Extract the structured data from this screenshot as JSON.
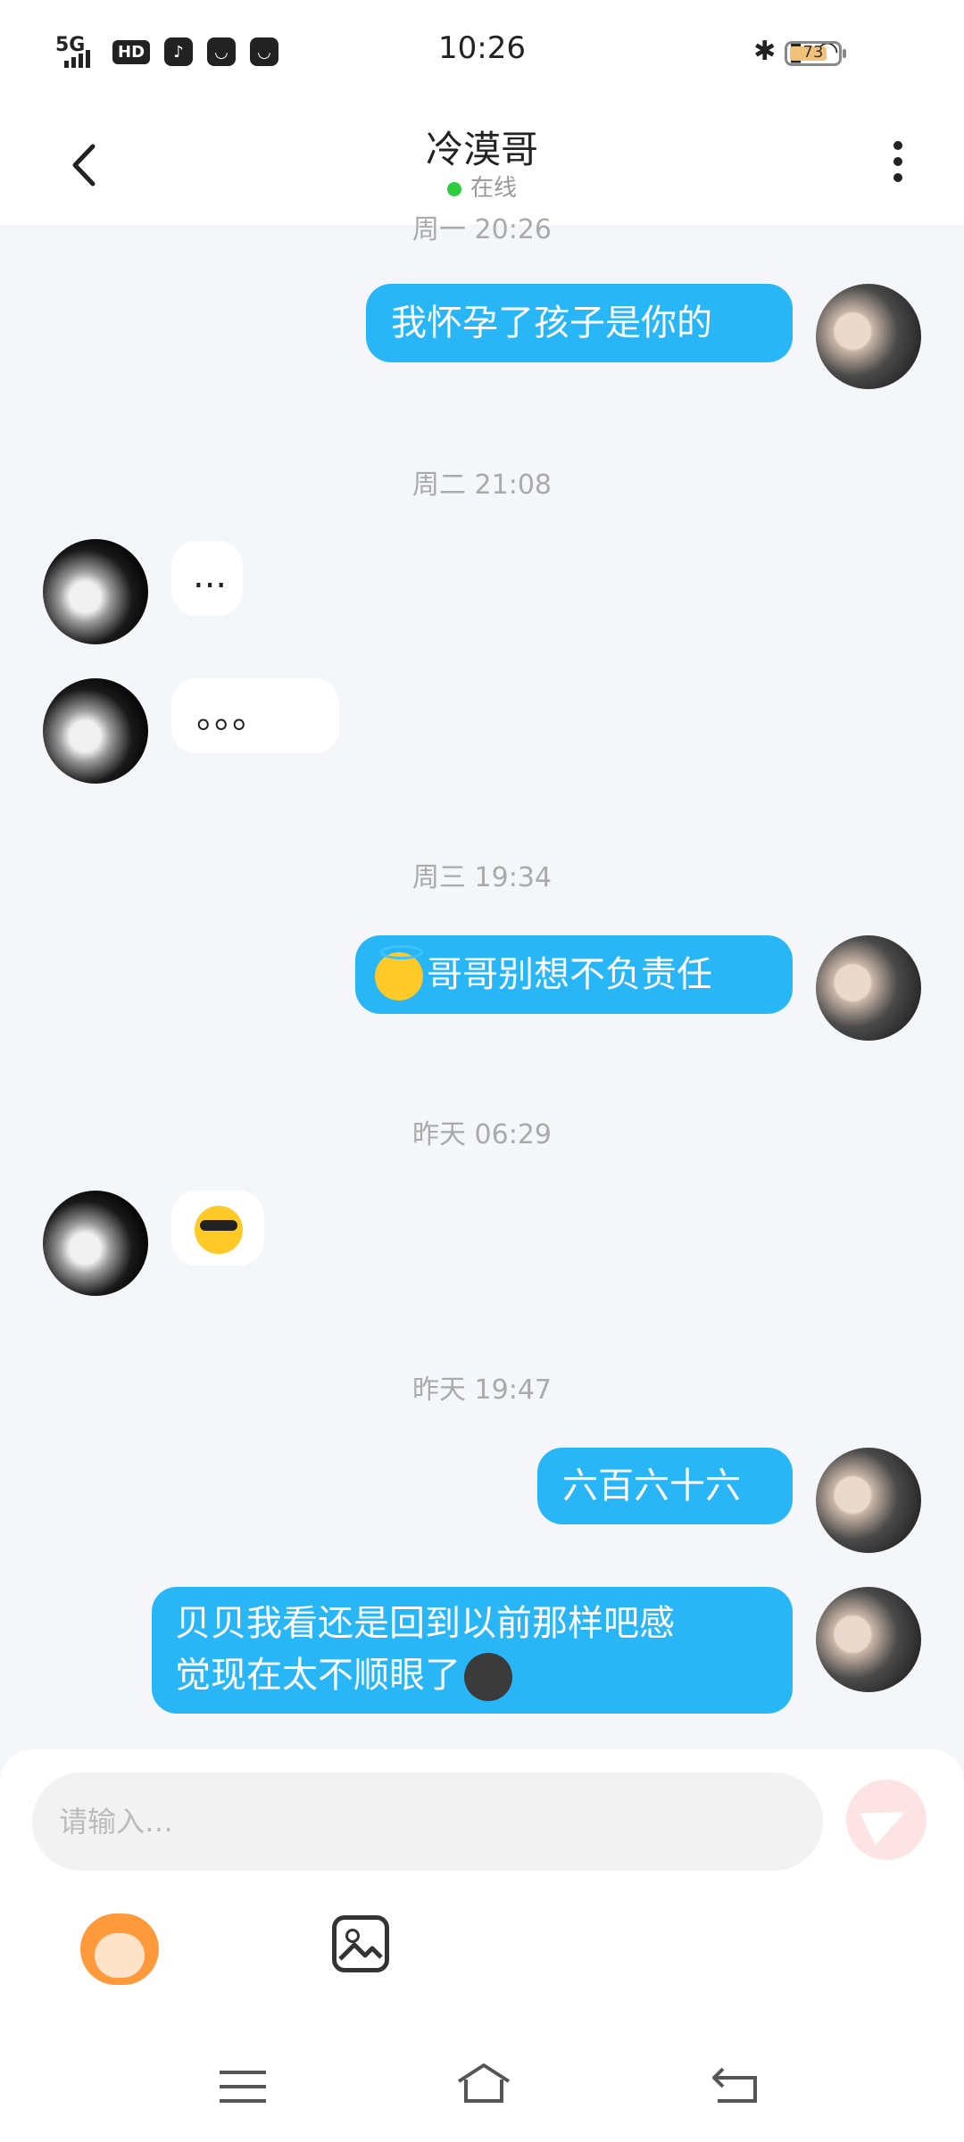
{
  "status_bar": {
    "network": "5G",
    "hd": "HD",
    "time": "10:26",
    "battery": "73",
    "battery_level": 0.73
  },
  "header": {
    "title": "冷漠哥",
    "status": "在线"
  },
  "messages": {
    "ts0": "周一 20:26",
    "m1": "我怀孕了孩子是你的",
    "ts1": "周二 21:08",
    "m2": "...",
    "m3": "。。。",
    "ts2": "周三 19:34",
    "m4": "哥哥别想不负责任",
    "ts3": "昨天 06:29",
    "ts4": "昨天 19:47",
    "m6": "六百六十六",
    "m7_line1": "贝贝我看还是回到以前那样吧感",
    "m7_line2": "觉现在太不顺眼了"
  },
  "emojis": {
    "m4": "smiling-face-with-halo",
    "m5": "smiling-face-with-sunglasses",
    "m7": "new-moon-face"
  },
  "input": {
    "placeholder": "请输入…"
  },
  "colors": {
    "outgoing_bubble": "#29b6f6",
    "incoming_bubble": "#ffffff",
    "background": "#f4f6f9",
    "online_dot": "#2ecc40",
    "send_button": "#fde3e3"
  }
}
